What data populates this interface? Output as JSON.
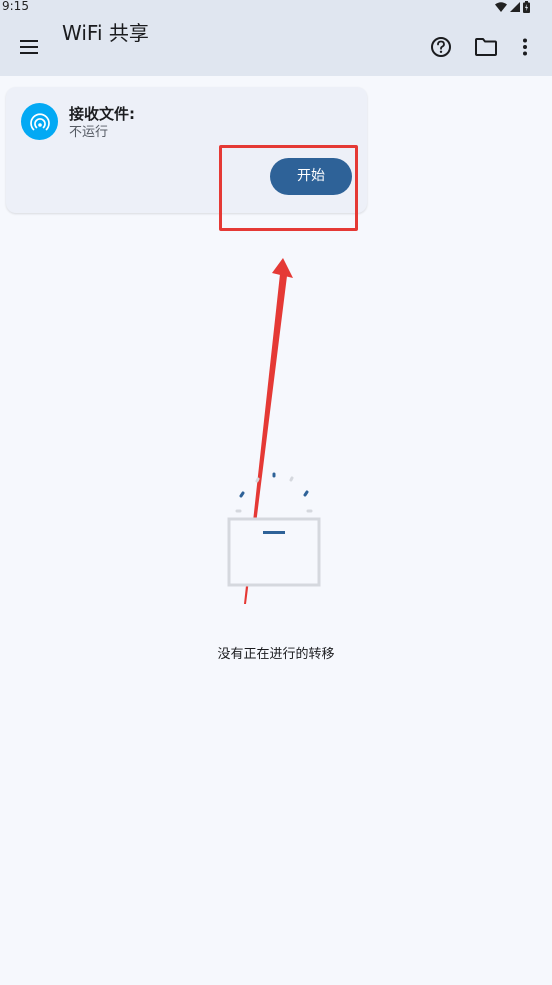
{
  "status_bar": {
    "time": "9:15",
    "icons": [
      "wifi-icon",
      "signal-icon",
      "battery-icon"
    ]
  },
  "app_bar": {
    "title": "WiFi 共享",
    "menu_icon": "menu-icon",
    "actions": [
      "help-icon",
      "folder-icon",
      "more-vert-icon"
    ]
  },
  "receive_card": {
    "title": "接收文件:",
    "status": "不运行",
    "icon": "wifi-receive-icon",
    "button_label": "开始"
  },
  "empty_state": {
    "message": "没有正在进行的转移",
    "icon": "transfer-box-icon"
  },
  "colors": {
    "app_bar_bg": "#e0e6f0",
    "page_bg": "#f6f8fd",
    "card_bg": "#edf0f8",
    "accent": "#03a9f4",
    "button": "#2e6298",
    "annotation": "#e53935"
  }
}
